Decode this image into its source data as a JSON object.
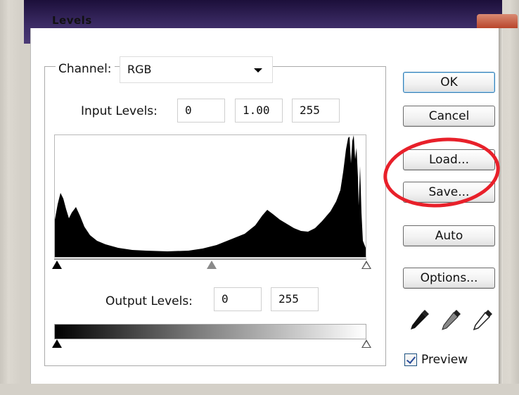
{
  "window": {
    "title": "Levels"
  },
  "channel": {
    "label": "Channel:",
    "value": "RGB"
  },
  "input_levels": {
    "label": "Input Levels:",
    "black": "0",
    "gamma": "1.00",
    "white": "255"
  },
  "output_levels": {
    "label": "Output Levels:",
    "black": "0",
    "white": "255"
  },
  "buttons": {
    "ok": "OK",
    "cancel": "Cancel",
    "load": "Load...",
    "save": "Save...",
    "auto": "Auto",
    "options": "Options..."
  },
  "preview": {
    "label": "Preview",
    "checked": true
  },
  "eyedroppers": [
    "black-eyedropper-icon",
    "gray-eyedropper-icon",
    "white-eyedropper-icon"
  ],
  "input_slider_levels": {
    "black": 0,
    "gray": 0.5,
    "white": 1
  },
  "output_slider_levels": {
    "black": 0,
    "white": 1
  },
  "colors": {
    "annotation": "#e8202a",
    "ok_border": "#3c7fb1"
  }
}
